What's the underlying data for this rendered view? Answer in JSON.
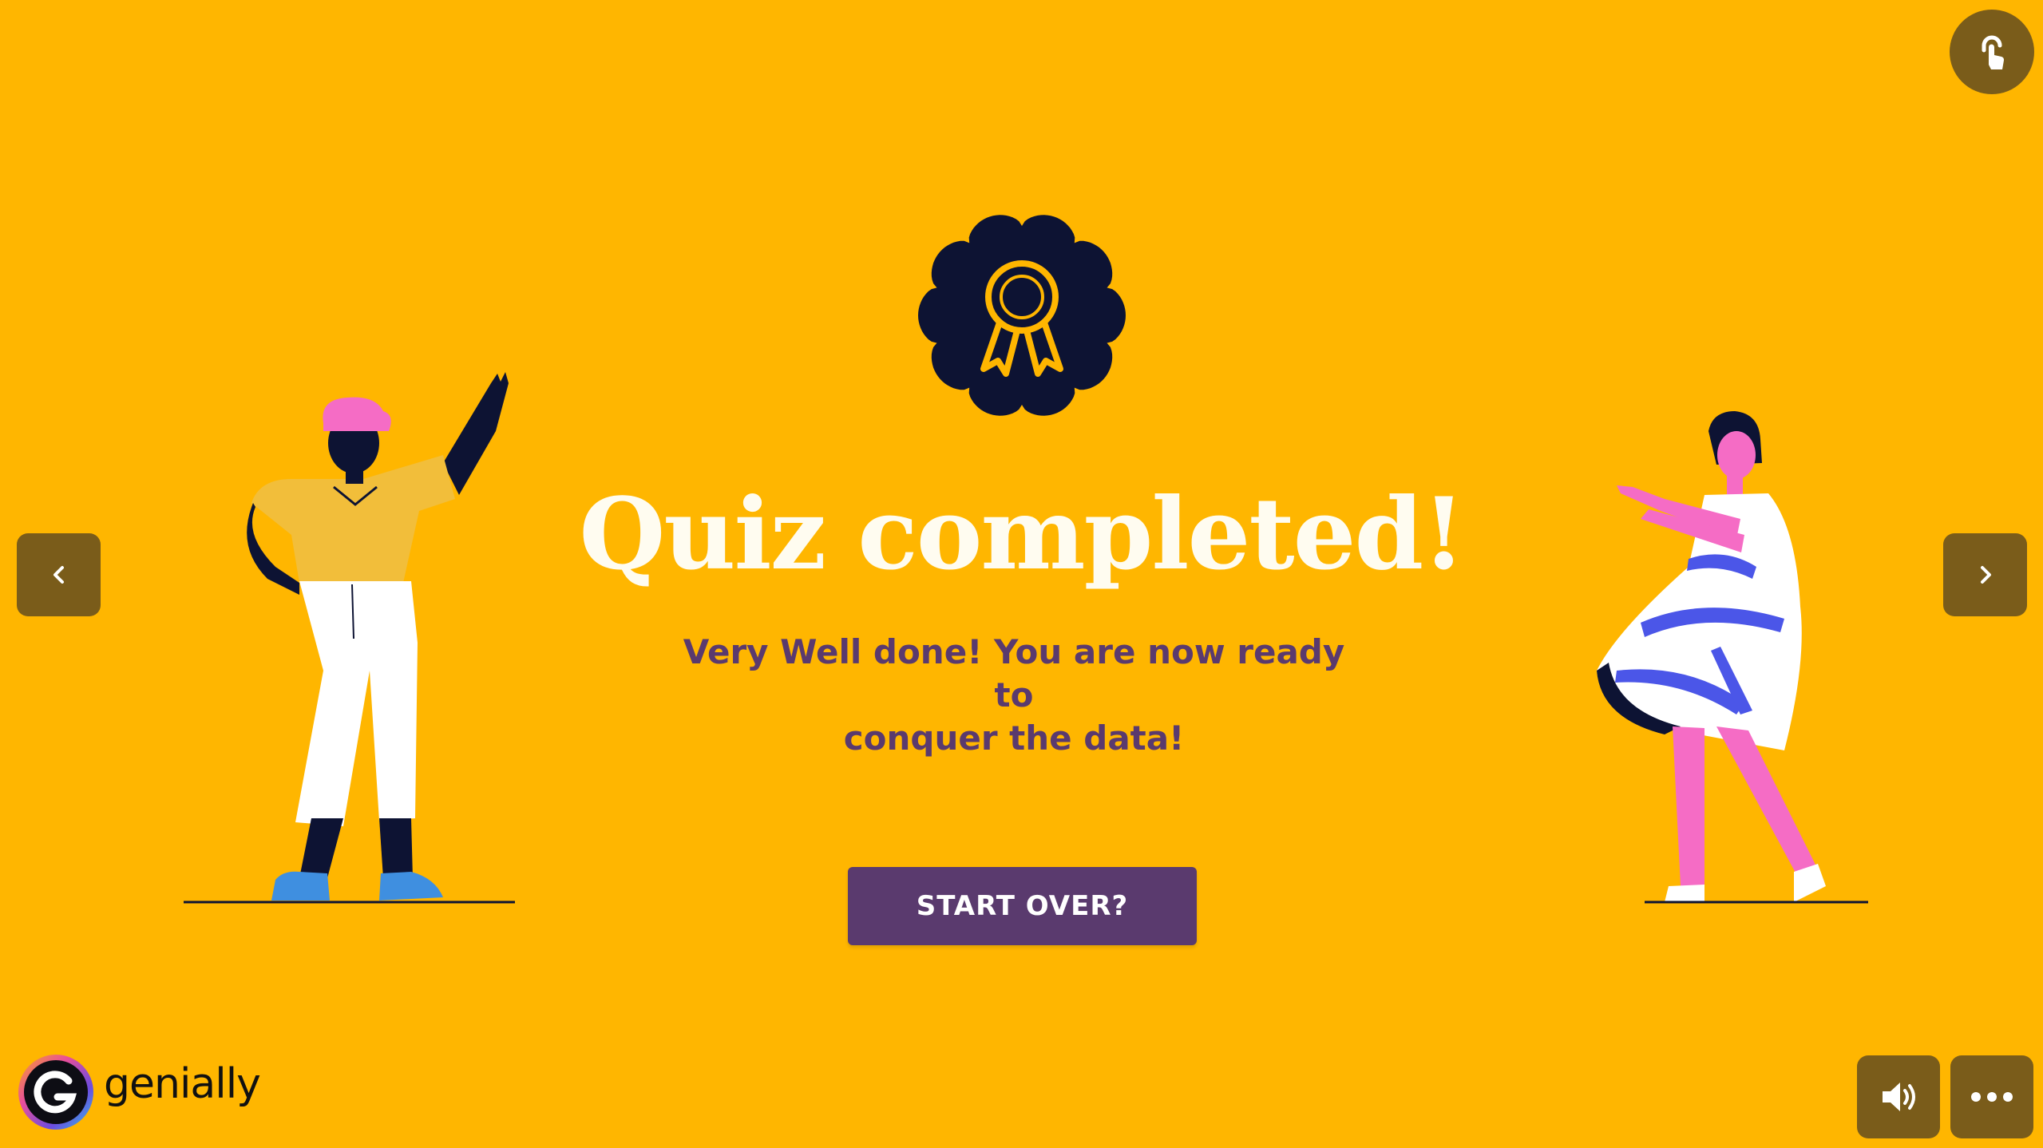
{
  "slide": {
    "title": "Quiz completed!",
    "subtitle_line1": "Very Well done! You are now ready to",
    "subtitle_line2": "conquer the data!",
    "button_label": "START OVER?"
  },
  "brand": {
    "name": "genially"
  },
  "icons": {
    "badge": "award-ribbon-icon",
    "top_right": "touch-interaction-icon",
    "prev": "chevron-left-icon",
    "next": "chevron-right-icon",
    "sound": "speaker-icon",
    "more": "more-dots-icon"
  },
  "colors": {
    "background": "#FFB600",
    "title": "#FFFCF0",
    "subtitle": "#5A3A6E",
    "button": "#5A3A6E",
    "controls": "#7A5C1A",
    "badge": "#0D1333"
  }
}
